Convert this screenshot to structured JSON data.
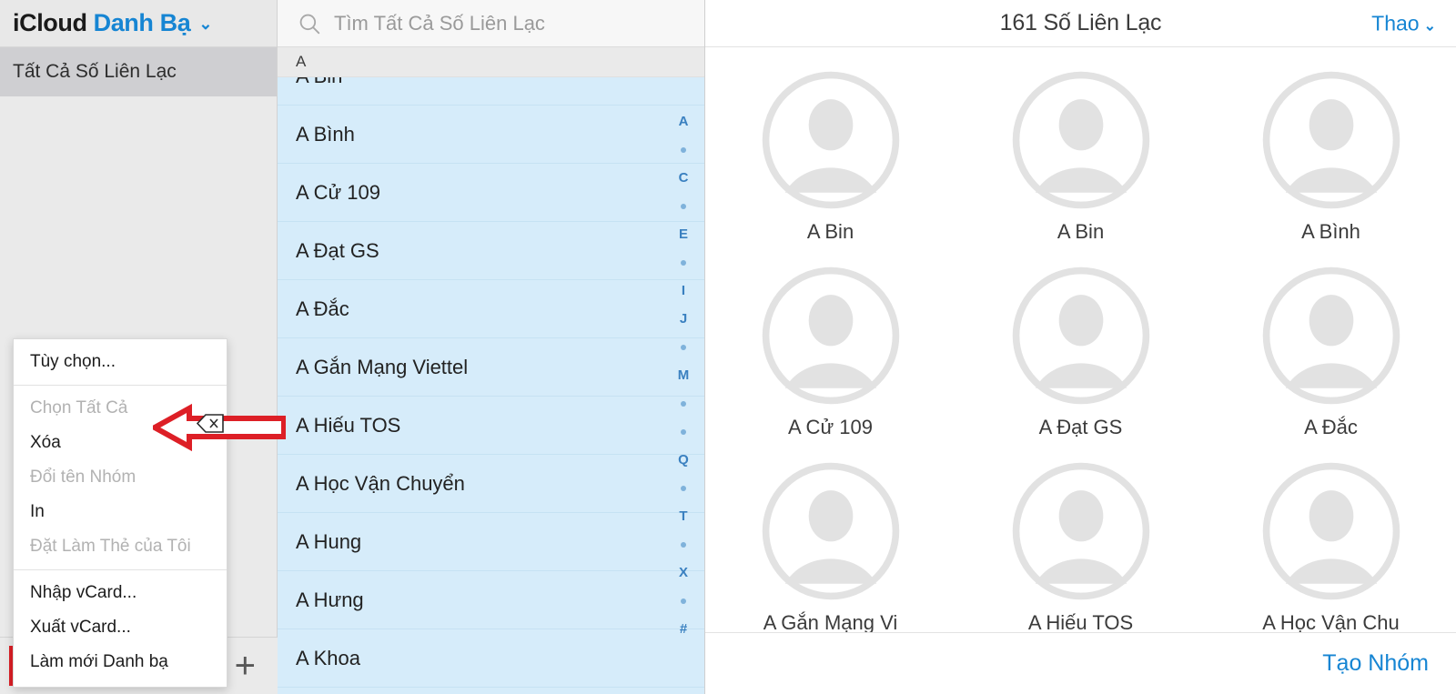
{
  "brand": {
    "icloud": "iCloud",
    "app": "Danh Bạ",
    "caret": "⌄"
  },
  "sidebar": {
    "items": [
      {
        "label": "Tất Cả Số Liên Lạc",
        "selected": true
      }
    ],
    "footer": {
      "gear_icon": "gear-icon",
      "add_label": "+"
    }
  },
  "context_menu": {
    "groups": [
      [
        {
          "label": "Tùy chọn...",
          "disabled": false
        }
      ],
      [
        {
          "label": "Chọn Tất Cả",
          "disabled": true
        },
        {
          "label": "Xóa",
          "disabled": false
        },
        {
          "label": "Đổi tên Nhóm",
          "disabled": true
        },
        {
          "label": "In",
          "disabled": false
        },
        {
          "label": "Đặt Làm Thẻ của Tôi",
          "disabled": true
        }
      ],
      [
        {
          "label": "Nhập vCard...",
          "disabled": false
        },
        {
          "label": "Xuất vCard...",
          "disabled": false
        },
        {
          "label": "Làm mới Danh bạ",
          "disabled": false
        }
      ]
    ]
  },
  "annotation": {
    "arrow_color": "#dd1f26",
    "arrow_direction": "left",
    "cursor_icon": "delete-key-cursor-icon"
  },
  "search": {
    "icon": "search-icon",
    "placeholder": "Tìm Tất Cả Số Liên Lạc",
    "value": ""
  },
  "list": {
    "section_header": "A",
    "rows": [
      {
        "name": "A Bin"
      },
      {
        "name": "A Bình"
      },
      {
        "name": "A Cử 109"
      },
      {
        "name": "A Đạt GS"
      },
      {
        "name": "A Đắc"
      },
      {
        "name": "A Gắn Mạng Viettel"
      },
      {
        "name": "A Hiếu TOS"
      },
      {
        "name": "A Học Vận Chuyển"
      },
      {
        "name": "A Hung"
      },
      {
        "name": "A Hưng"
      },
      {
        "name": "A Khoa"
      }
    ],
    "index_rail": [
      "A",
      "•",
      "C",
      "•",
      "E",
      "•",
      "I",
      "J",
      "•",
      "M",
      "•",
      "•",
      "Q",
      "•",
      "T",
      "•",
      "X",
      "•",
      "#"
    ]
  },
  "detail": {
    "title": "161 Số Liên Lạc",
    "actions_label": "Thao",
    "actions_caret": "⌄",
    "cards": [
      {
        "name": "A Bin"
      },
      {
        "name": "A Bin"
      },
      {
        "name": "A Bình"
      },
      {
        "name": "A Cử 109"
      },
      {
        "name": "A Đạt GS"
      },
      {
        "name": "A Đắc"
      },
      {
        "name": "A Gắn Mạng Vi"
      },
      {
        "name": "A Hiếu TOS"
      },
      {
        "name": "A Học Vận Chu"
      }
    ],
    "footer": {
      "create_group_label": "Tạo Nhóm"
    }
  },
  "colors": {
    "accent_blue": "#1685d3",
    "list_selection": "#d6ecfa",
    "annotation_red": "#dd1f26",
    "sidebar_bg": "#eaeaea"
  }
}
